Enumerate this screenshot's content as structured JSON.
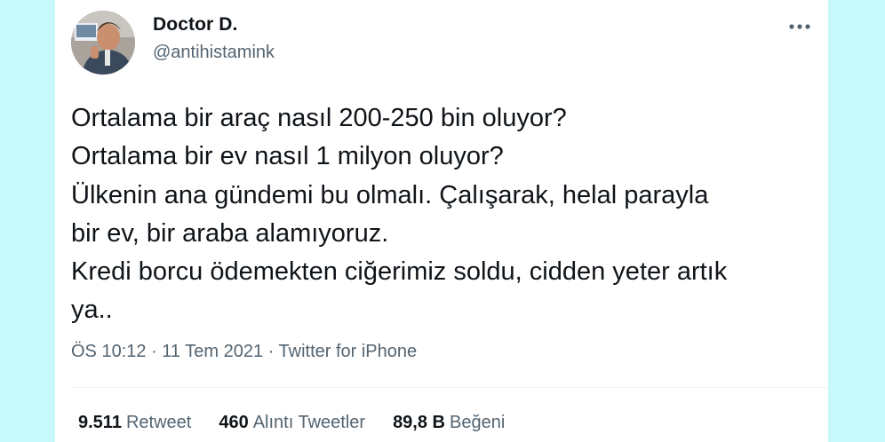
{
  "author": {
    "display_name": "Doctor D.",
    "handle": "@antihistamink"
  },
  "tweet": {
    "text": "Ortalama bir araç nasıl 200-250 bin oluyor?\nOrtalama bir ev nasıl 1 milyon oluyor?\nÜlkenin ana gündemi bu olmalı. Çalışarak, helal parayla\nbir ev, bir araba alamıyoruz.\nKredi borcu ödemekten ciğerimiz soldu, cidden yeter artık\nya.."
  },
  "meta": {
    "time": "ÖS 10:12",
    "separator": " · ",
    "date": "11 Tem 2021",
    "source": "Twitter for iPhone"
  },
  "stats": [
    {
      "count": "9.511",
      "label": "Retweet"
    },
    {
      "count": "460",
      "label": "Alıntı Tweetler"
    },
    {
      "count": "89,8 B",
      "label": "Beğeni"
    }
  ],
  "icons": {
    "more": "more-horizontal-icon",
    "avatar": "profile-photo"
  },
  "colors": {
    "background": "#c7f8fb",
    "card": "#ffffff",
    "text_primary": "#0f1419",
    "text_secondary": "#536471",
    "divider": "#eff3f4"
  }
}
